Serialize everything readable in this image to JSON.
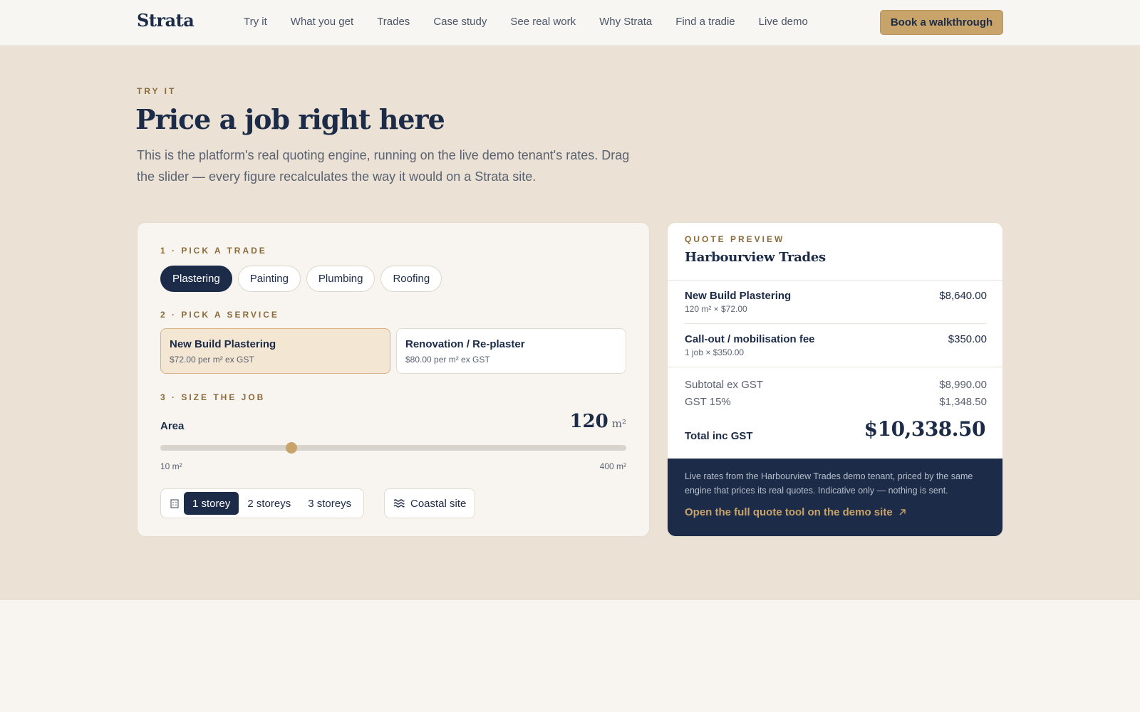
{
  "header": {
    "logo": "Strata",
    "nav": [
      "Try it",
      "What you get",
      "Trades",
      "Case study",
      "See real work",
      "Why Strata",
      "Find a tradie",
      "Live demo"
    ],
    "cta": "Book a walkthrough"
  },
  "hero": {
    "eyebrow": "TRY IT",
    "title": "Price a job right here",
    "lede": "This is the platform's real quoting engine, running on the live demo tenant's rates. Drag the slider — every figure recalculates the way it would on a Strata site."
  },
  "builder": {
    "step1": "1 · PICK A TRADE",
    "trades": [
      {
        "label": "Plastering",
        "selected": true
      },
      {
        "label": "Painting",
        "selected": false
      },
      {
        "label": "Plumbing",
        "selected": false
      },
      {
        "label": "Roofing",
        "selected": false
      }
    ],
    "step2": "2 · PICK A SERVICE",
    "services": [
      {
        "name": "New Build Plastering",
        "rate": "$72.00 per m² ex GST",
        "selected": true
      },
      {
        "name": "Renovation / Re-plaster",
        "rate": "$80.00 per m² ex GST",
        "selected": false
      }
    ],
    "step3": "3 · SIZE THE JOB",
    "area": {
      "label": "Area",
      "value": "120",
      "unit": "m²",
      "min": 10,
      "max": 400,
      "min_label": "10 m²",
      "max_label": "400 m²"
    },
    "storeys": [
      {
        "label": "1 storey",
        "selected": true
      },
      {
        "label": "2 storeys",
        "selected": false
      },
      {
        "label": "3 storeys",
        "selected": false
      }
    ],
    "coastal": "Coastal site"
  },
  "quote": {
    "eyebrow": "QUOTE PREVIEW",
    "company": "Harbourview Trades",
    "items": [
      {
        "name": "New Build Plastering",
        "detail": "120 m² × $72.00",
        "amount": "$8,640.00"
      },
      {
        "name": "Call-out / mobilisation fee",
        "detail": "1 job × $350.00",
        "amount": "$350.00"
      }
    ],
    "subtotal_label": "Subtotal ex GST",
    "subtotal": "$8,990.00",
    "gst_label": "GST 15%",
    "gst": "$1,348.50",
    "total_label": "Total inc GST",
    "total": "$10,338.50",
    "note": "Live rates from the Harbourview Trades demo tenant, priced by the same engine that prices its real quotes. Indicative only — nothing is sent.",
    "link": "Open the full quote tool on the demo site"
  },
  "colors": {
    "navy": "#1c2b47",
    "gold": "#c8a46a",
    "sand": "#ebe2d5",
    "cream": "#f8f5f0"
  }
}
